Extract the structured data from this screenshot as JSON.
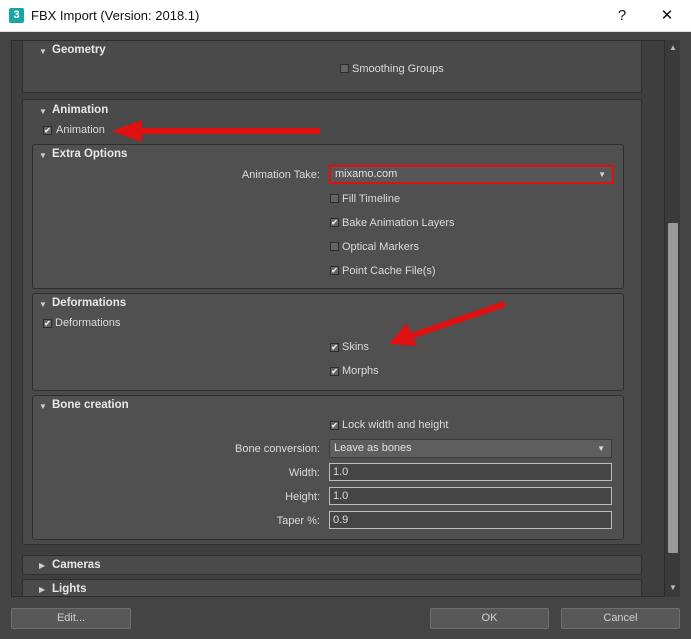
{
  "window": {
    "app_icon": "3",
    "title": "FBX Import (Version: 2018.1)",
    "help_glyph": "?",
    "close_glyph": "✕"
  },
  "geometry": {
    "title": "Geometry",
    "smoothing_groups": {
      "label": "Smoothing Groups",
      "checked": false
    }
  },
  "animation": {
    "title": "Animation",
    "animation_checkbox": {
      "label": "Animation",
      "checked": true
    },
    "extra_options": {
      "title": "Extra Options",
      "animation_take_label": "Animation Take:",
      "animation_take_value": "mixamo.com",
      "fill_timeline": {
        "label": "Fill Timeline",
        "checked": false
      },
      "bake_animation_layers": {
        "label": "Bake Animation Layers",
        "checked": true
      },
      "optical_markers": {
        "label": "Optical Markers",
        "checked": false
      },
      "point_cache_files": {
        "label": "Point Cache File(s)",
        "checked": true
      }
    },
    "deformations": {
      "title": "Deformations",
      "deformations_checkbox": {
        "label": "Deformations",
        "checked": true
      },
      "skins": {
        "label": "Skins",
        "checked": true
      },
      "morphs": {
        "label": "Morphs",
        "checked": true
      }
    },
    "bone_creation": {
      "title": "Bone creation",
      "lock_width_height": {
        "label": "Lock width and height",
        "checked": true
      },
      "bone_conversion_label": "Bone conversion:",
      "bone_conversion_value": "Leave as bones",
      "width_label": "Width:",
      "width_value": "1.0",
      "height_label": "Height:",
      "height_value": "1.0",
      "taper_label": "Taper %:",
      "taper_value": "0.9"
    }
  },
  "cameras": {
    "title": "Cameras"
  },
  "lights": {
    "title": "Lights"
  },
  "buttons": {
    "edit": "Edit...",
    "ok": "OK",
    "cancel": "Cancel"
  },
  "glyphs": {
    "expanded": "▼",
    "collapsed": "▶",
    "check": "✔",
    "dropdown": "▼",
    "scroll_up": "▲",
    "scroll_down": "▼"
  },
  "colors": {
    "annotation_red": "#e01010",
    "panel_bg": "#4a4a4a",
    "dialog_bg": "#444444"
  }
}
